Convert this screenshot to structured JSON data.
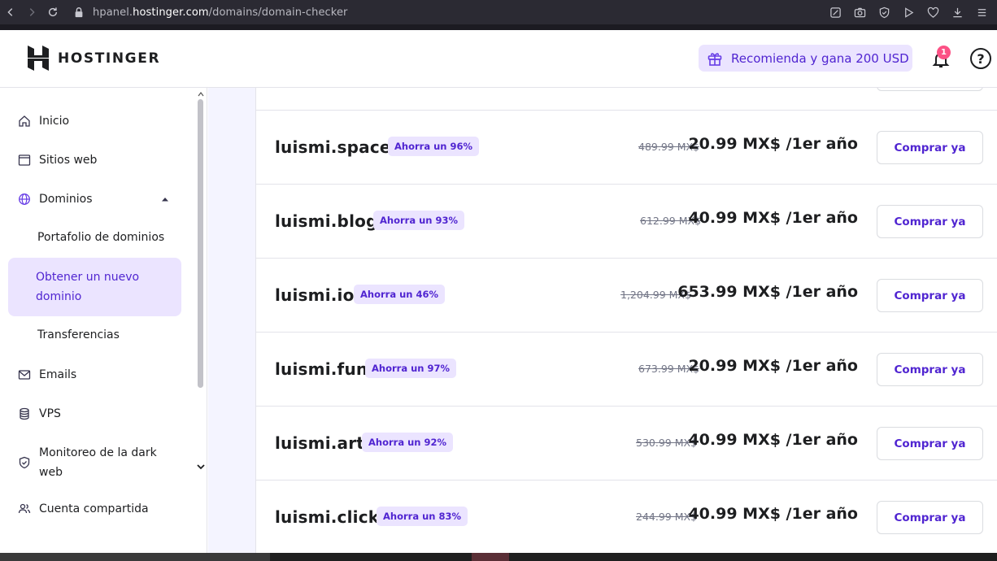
{
  "browser": {
    "url_prefix": "hpanel.",
    "url_domain": "hostinger.com",
    "url_path": "/domains/domain-checker",
    "icons": [
      "back-icon",
      "forward-icon",
      "reload-icon",
      "lock-icon",
      "edit-icon",
      "camera-icon",
      "shield-icon",
      "play-icon",
      "heart-icon",
      "download-icon",
      "menu-icon"
    ]
  },
  "header": {
    "logo_text": "HOSTINGER",
    "referral_label": "Recomienda y gana 200 USD",
    "notification_count": "1",
    "help_label": "?"
  },
  "sidebar": {
    "items": [
      {
        "label": "Inicio",
        "icon": "home-icon"
      },
      {
        "label": "Sitios web",
        "icon": "browser-icon"
      },
      {
        "label": "Dominios",
        "icon": "globe-icon"
      },
      {
        "label": "Portafolio de dominios"
      },
      {
        "label": "Obtener un nuevo dominio"
      },
      {
        "label": "Transferencias"
      },
      {
        "label": "Emails",
        "icon": "mail-icon"
      },
      {
        "label": "VPS",
        "icon": "server-icon"
      },
      {
        "label": "Monitoreo de la dark web",
        "icon": "shield-icon"
      },
      {
        "label": "Cuenta compartida",
        "icon": "users-icon"
      }
    ]
  },
  "domains": [
    {
      "name": "luismi.space",
      "badge": "Ahorra un 96%",
      "old_price": "489.99 MX$",
      "price": "20.99 MX$ /1er año",
      "button": "Comprar ya"
    },
    {
      "name": "luismi.blog",
      "badge": "Ahorra un 93%",
      "old_price": "612.99 MX$",
      "price": "40.99 MX$ /1er año",
      "button": "Comprar ya"
    },
    {
      "name": "luismi.io",
      "badge": "Ahorra un 46%",
      "old_price": "1,204.99 MX$",
      "price": "653.99 MX$ /1er año",
      "button": "Comprar ya"
    },
    {
      "name": "luismi.fun",
      "badge": "Ahorra un 97%",
      "old_price": "673.99 MX$",
      "price": "20.99 MX$ /1er año",
      "button": "Comprar ya"
    },
    {
      "name": "luismi.art",
      "badge": "Ahorra un 92%",
      "old_price": "530.99 MX$",
      "price": "40.99 MX$ /1er año",
      "button": "Comprar ya"
    },
    {
      "name": "luismi.click",
      "badge": "Ahorra un 83%",
      "old_price": "244.99 MX$",
      "price": "40.99 MX$ /1er año",
      "button": "Comprar ya"
    }
  ],
  "colors": {
    "accent": "#673de6",
    "accent_dark": "#5025d1",
    "accent_light": "#ebe4ff",
    "notification": "#fc5185"
  }
}
